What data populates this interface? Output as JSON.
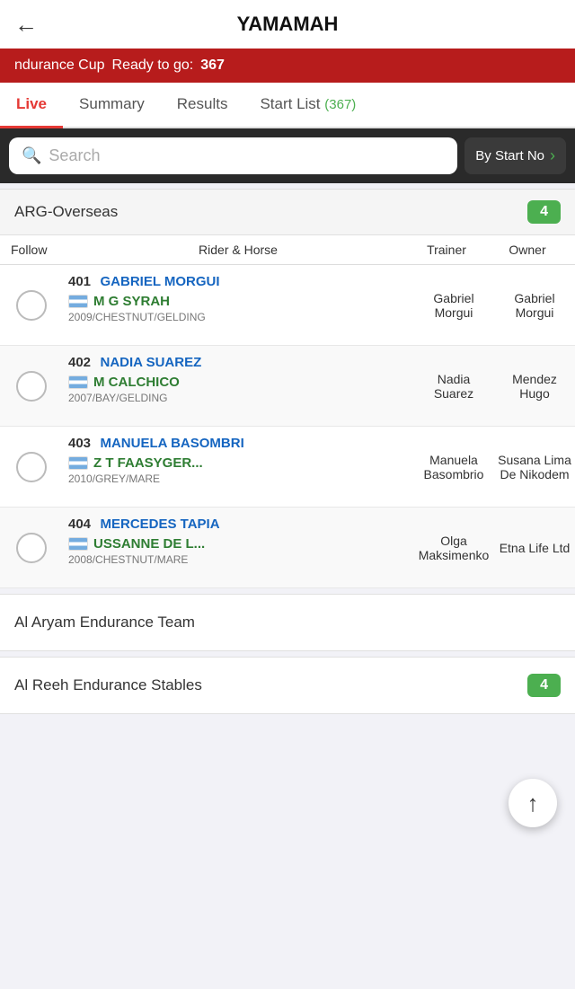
{
  "header": {
    "back_label": "←",
    "title": "YAMAMAH"
  },
  "banner": {
    "text": "ndurance Cup",
    "ready_label": "Ready to go:",
    "count": "367"
  },
  "tabs": [
    {
      "id": "live",
      "label": "Live",
      "active": true
    },
    {
      "id": "summary",
      "label": "Summary",
      "active": false
    },
    {
      "id": "results",
      "label": "Results",
      "active": false
    },
    {
      "id": "startlist",
      "label": "Start List",
      "badge": "(367)",
      "active": false
    }
  ],
  "search": {
    "placeholder": "Search",
    "sort_label": "By Start No"
  },
  "group": {
    "name": "ARG-Overseas",
    "count": "4"
  },
  "table_headers": {
    "follow": "Follow",
    "rider_horse": "Rider & Horse",
    "trainer": "Trainer",
    "owner": "Owner"
  },
  "entries": [
    {
      "num": "401",
      "rider_name": "GABRIEL MORGUI",
      "horse_name": "M G SYRAH",
      "horse_info": "2009/CHESTNUT/GELDING",
      "trainer": "Gabriel Morgui",
      "owner": "Gabriel Morgui"
    },
    {
      "num": "402",
      "rider_name": "NADIA SUAREZ",
      "horse_name": "M CALCHICO",
      "horse_info": "2007/BAY/GELDING",
      "trainer": "Nadia Suarez",
      "owner": "Mendez Hugo"
    },
    {
      "num": "403",
      "rider_name": "MANUELA BASOMBRI",
      "horse_name": "Z T FAASYGER...",
      "horse_info": "2010/GREY/MARE",
      "trainer": "Manuela Basombrio",
      "owner": "Susana Lima De Nikodem"
    },
    {
      "num": "404",
      "rider_name": "MERCEDES TAPIA",
      "horse_name": "USSANNE DE L...",
      "horse_info": "2008/CHESTNUT/MARE",
      "trainer": "Olga Maksimenko",
      "owner": "Etna Life Ltd"
    }
  ],
  "bottom_groups": [
    {
      "name": "Al Aryam Endurance Team",
      "count": null
    },
    {
      "name": "Al Reeh Endurance Stables",
      "count": "4"
    }
  ],
  "fab": {
    "icon": "↑"
  }
}
